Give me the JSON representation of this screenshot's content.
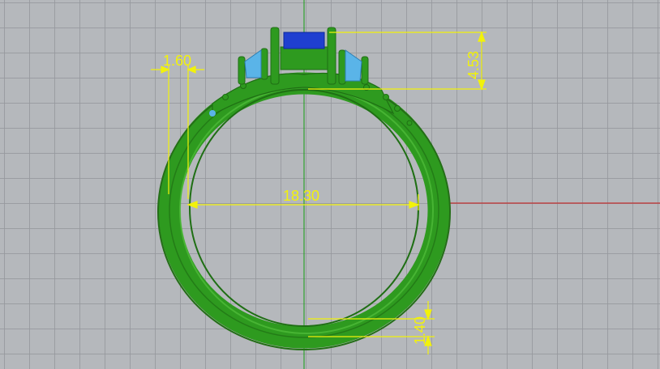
{
  "viewport": {
    "background": "#b5b8bc",
    "grid_color": "#9a9da2",
    "x_axis_color": "#c03030",
    "y_axis_color": "#2fa02f"
  },
  "model": {
    "name": "ring",
    "body_color": "#2e9a1f",
    "stone_color": "#1f3fd0",
    "side_stone_color": "#5ab4e8"
  },
  "dimensions": {
    "color": "#f2f20a",
    "shank_width": "1.60",
    "inner_diameter": "18.30",
    "head_height": "4.53",
    "band_thickness": "1.40"
  }
}
